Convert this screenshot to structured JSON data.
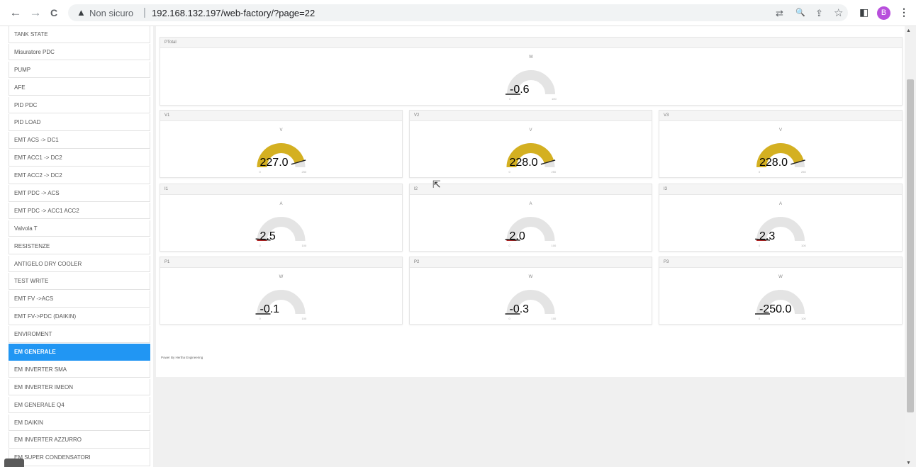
{
  "browser": {
    "back_icon": "←",
    "forward_icon": "→",
    "reload_icon": "C",
    "warning_icon": "▲",
    "security_label": "Non sicuro",
    "separator": "|",
    "url": "192.168.132.197/web-factory/?page=22",
    "translate_icon": "⇄",
    "zoom_icon": "🔍",
    "share_icon": "⇪",
    "star_icon": "☆",
    "sidepanel_icon": "◧",
    "profile_initial": "B",
    "menu_icon": "⋮"
  },
  "sidebar": {
    "items": [
      {
        "label": "TANK STATE"
      },
      {
        "label": "Misuratore PDC"
      },
      {
        "label": "PUMP"
      },
      {
        "label": "AFE"
      },
      {
        "label": "PID PDC"
      },
      {
        "label": "PID LOAD"
      },
      {
        "label": "EMT ACS -> DC1"
      },
      {
        "label": "EMT ACC1 -> DC2"
      },
      {
        "label": "EMT ACC2 -> DC2"
      },
      {
        "label": "EMT PDC -> ACS"
      },
      {
        "label": "EMT PDC -> ACC1 ACC2"
      },
      {
        "label": "Valvola T"
      },
      {
        "label": "RESISTENZE"
      },
      {
        "label": "ANTIGELO DRY COOLER"
      },
      {
        "label": "TEST WRITE"
      },
      {
        "label": "EMT FV ->ACS"
      },
      {
        "label": "EMT FV->PDC (DAIKIN)"
      },
      {
        "label": "ENVIROMENT"
      },
      {
        "label": "EM GENERALE",
        "active": true
      },
      {
        "label": "EM INVERTER SMA"
      },
      {
        "label": "EM INVERTER IMEON"
      },
      {
        "label": "EM GENERALE Q4"
      },
      {
        "label": "EM DAIKIN"
      },
      {
        "label": "EM INVERTER AZZURRO"
      },
      {
        "label": "EM SUPER CONDENSATORI"
      }
    ]
  },
  "gauges": [
    {
      "title": "PTotal",
      "unit": "W",
      "value": "-0.6",
      "fraction": 0.0,
      "min": "0",
      "max": "100",
      "color": "#cccccc"
    },
    {
      "title": "V1",
      "unit": "V",
      "value": "227.0",
      "fraction": 0.91,
      "min": "0",
      "max": "250",
      "color": "#d4b021"
    },
    {
      "title": "V2",
      "unit": "V",
      "value": "228.0",
      "fraction": 0.91,
      "min": "0",
      "max": "250",
      "color": "#d4b021"
    },
    {
      "title": "V3",
      "unit": "V",
      "value": "228.0",
      "fraction": 0.91,
      "min": "0",
      "max": "250",
      "color": "#d4b021"
    },
    {
      "title": "I1",
      "unit": "A",
      "value": "2.5",
      "fraction": 0.025,
      "min": "0",
      "max": "100",
      "color": "#b22222"
    },
    {
      "title": "I2",
      "unit": "A",
      "value": "2.0",
      "fraction": 0.02,
      "min": "0",
      "max": "100",
      "color": "#b22222"
    },
    {
      "title": "I3",
      "unit": "A",
      "value": "2.3",
      "fraction": 0.023,
      "min": "0",
      "max": "100",
      "color": "#b22222"
    },
    {
      "title": "P1",
      "unit": "W",
      "value": "-0.1",
      "fraction": 0.0,
      "min": "0",
      "max": "100",
      "color": "#cccccc"
    },
    {
      "title": "P2",
      "unit": "W",
      "value": "-0.3",
      "fraction": 0.0,
      "min": "0",
      "max": "100",
      "color": "#cccccc"
    },
    {
      "title": "P3",
      "unit": "W",
      "value": "-250.0",
      "fraction": 0.0,
      "min": "0",
      "max": "100",
      "color": "#cccccc"
    }
  ],
  "footer": {
    "text": "Power By Hertha Engineering"
  }
}
